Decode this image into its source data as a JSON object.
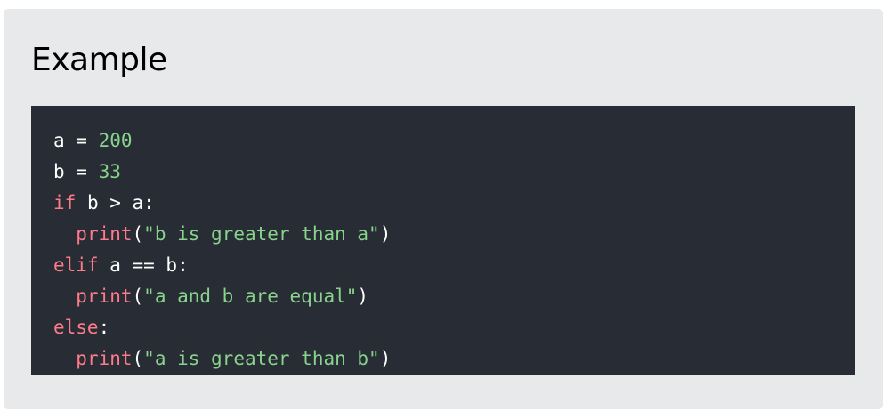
{
  "example": {
    "heading": "Example"
  },
  "code": {
    "lines": [
      [
        {
          "t": "a = ",
          "c": "op"
        },
        {
          "t": "200",
          "c": "num"
        }
      ],
      [
        {
          "t": "b = ",
          "c": "op"
        },
        {
          "t": "33",
          "c": "num"
        }
      ],
      [
        {
          "t": "if",
          "c": "kw"
        },
        {
          "t": " b > a:",
          "c": "op"
        }
      ],
      [
        {
          "t": "  ",
          "c": "op"
        },
        {
          "t": "print",
          "c": "fn"
        },
        {
          "t": "(",
          "c": "op"
        },
        {
          "t": "\"b is greater than a\"",
          "c": "str"
        },
        {
          "t": ")",
          "c": "op"
        }
      ],
      [
        {
          "t": "elif",
          "c": "kw"
        },
        {
          "t": " a == b:",
          "c": "op"
        }
      ],
      [
        {
          "t": "  ",
          "c": "op"
        },
        {
          "t": "print",
          "c": "fn"
        },
        {
          "t": "(",
          "c": "op"
        },
        {
          "t": "\"a and b are equal\"",
          "c": "str"
        },
        {
          "t": ")",
          "c": "op"
        }
      ],
      [
        {
          "t": "else",
          "c": "kw"
        },
        {
          "t": ":",
          "c": "op"
        }
      ],
      [
        {
          "t": "  ",
          "c": "op"
        },
        {
          "t": "print",
          "c": "fn"
        },
        {
          "t": "(",
          "c": "op"
        },
        {
          "t": "\"a is greater than b\"",
          "c": "str"
        },
        {
          "t": ")",
          "c": "op"
        }
      ]
    ]
  },
  "colors": {
    "card_background": "#e7e9eb",
    "code_background": "#282c34",
    "keyword": "#ff7b8a",
    "literal": "#88d48c",
    "text": "#ffffff"
  }
}
